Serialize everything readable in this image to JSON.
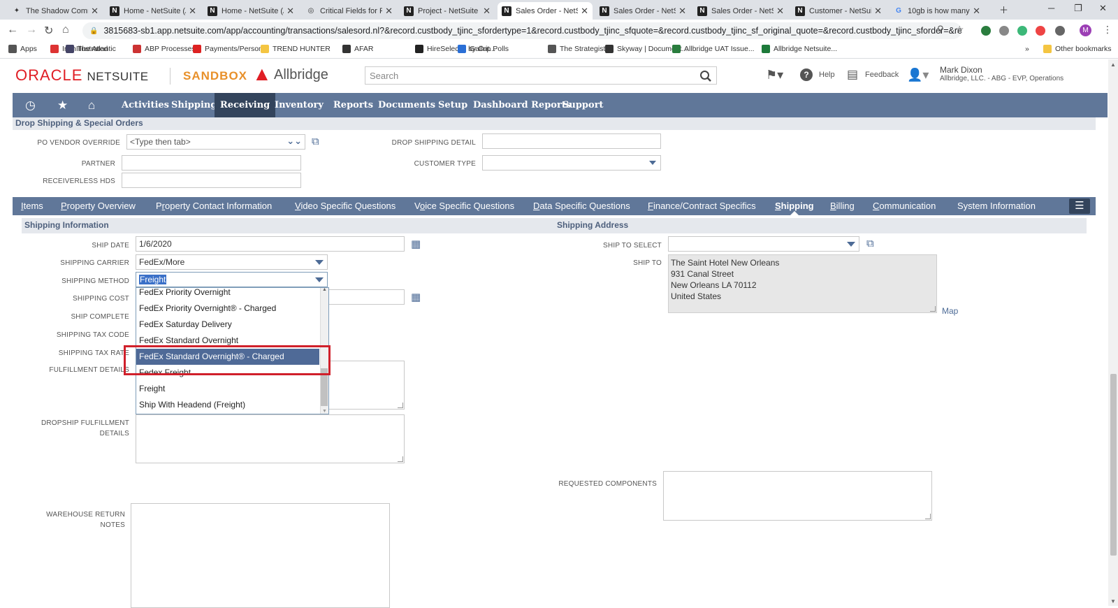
{
  "browser": {
    "tabs": [
      {
        "title": "The Shadow Comm",
        "icon": "pin-icon"
      },
      {
        "title": "Home - NetSuite (A",
        "icon": "netsuite-icon"
      },
      {
        "title": "Home - NetSuite (A",
        "icon": "netsuite-icon"
      },
      {
        "title": "Critical Fields for Fi",
        "icon": "globe-icon"
      },
      {
        "title": "Project - NetSuite (A",
        "icon": "netsuite-icon"
      },
      {
        "title": "Sales Order - NetSu",
        "icon": "netsuite-icon",
        "active": true
      },
      {
        "title": "Sales Order - NetSu",
        "icon": "netsuite-icon"
      },
      {
        "title": "Sales Order - NetSu",
        "icon": "netsuite-icon"
      },
      {
        "title": "Customer - NetSuit",
        "icon": "netsuite-icon"
      },
      {
        "title": "10gb is how many",
        "icon": "google-icon"
      }
    ],
    "url": "3815683-sb1.app.netsuite.com/app/accounting/transactions/salesord.nl?&record.custbody_tjinc_sfordertype=1&record.custbody_tjinc_sfquote=&record.custbody_tjinc_sf_original_quote=&record.custbody_tjinc_sforder=&record.c...",
    "bookmarks": [
      "Apps",
      "IrishIllustrated",
      "The Atlantic",
      "ABP Processes",
      "Payments/Personal",
      "TREND HUNTER",
      "AFAR",
      "HireSelect® by Crit...",
      "Gallup Polls",
      "The Strategist",
      "Skyway | Document...",
      "Allbridge UAT Issue...",
      "Allbridge Netsuite..."
    ],
    "other_bookmarks": "Other bookmarks",
    "profile_initial": "M"
  },
  "header": {
    "oracle": "ORACLE",
    "netsuite": "NETSUITE",
    "sandbox": "SANDBOX",
    "brand": "Allbridge",
    "search_placeholder": "Search",
    "help": "Help",
    "feedback": "Feedback",
    "user_name": "Mark Dixon",
    "user_role": "Allbridge, LLC. - ABG - EVP, Operations"
  },
  "nav": {
    "items": [
      "Activities",
      "Shipping",
      "Receiving",
      "Inventory",
      "Reports",
      "Documents",
      "Setup",
      "Dashboard Reports",
      "Support"
    ],
    "active": "Receiving"
  },
  "drop_shipping": {
    "title": "Drop Shipping & Special Orders",
    "po_vendor_override_label": "PO VENDOR OVERRIDE",
    "po_vendor_override_value": "<Type then tab>",
    "partner_label": "PARTNER",
    "receiverless_label": "RECEIVERLESS HDS",
    "drop_shipping_detail_label": "DROP SHIPPING DETAIL",
    "customer_type_label": "CUSTOMER TYPE"
  },
  "subtabs": [
    {
      "label": "Items",
      "u": "I",
      "rest": "tems"
    },
    {
      "label": "Property Overview",
      "u": "P",
      "rest": "roperty Overview"
    },
    {
      "pre": "P",
      "u": "r",
      "rest": "operty Contact Information"
    },
    {
      "u": "V",
      "rest": "ideo Specific Questions"
    },
    {
      "pre": "V",
      "u": "o",
      "rest": "ice Specific Questions"
    },
    {
      "u": "D",
      "rest": "ata Specific Questions"
    },
    {
      "u": "F",
      "rest": "inance/Contract Specifics"
    },
    {
      "u": "S",
      "rest": "hipping",
      "active": true
    },
    {
      "u": "B",
      "rest": "illing"
    },
    {
      "u": "C",
      "rest": "ommunication"
    },
    {
      "pre": "",
      "u": "",
      "rest": "System Information"
    }
  ],
  "shipping_info": {
    "title": "Shipping Information",
    "ship_date_label": "SHIP DATE",
    "ship_date_value": "1/6/2020",
    "carrier_label": "SHIPPING CARRIER",
    "carrier_value": "FedEx/More",
    "method_label": "SHIPPING METHOD",
    "method_value": "Freight",
    "cost_label": "SHIPPING COST",
    "complete_label": "SHIP COMPLETE",
    "tax_code_label": "SHIPPING TAX CODE",
    "tax_rate_label": "SHIPPING TAX RATE",
    "fulfillment_label": "FULFILLMENT DETAILS",
    "dropship_label_1": "DROPSHIP FULFILLMENT",
    "dropship_label_2": "DETAILS",
    "warehouse_label_1": "WAREHOUSE RETURN",
    "warehouse_label_2": "NOTES"
  },
  "method_options": [
    "FedEx Priority Overnight",
    "FedEx Priority Overnight® - Charged",
    "FedEx Saturday Delivery",
    "FedEx Standard Overnight",
    "FedEx Standard Overnight® - Charged",
    "Fedex Freight",
    "Freight",
    "Ship With Headend (Freight)"
  ],
  "highlighted_option_index": 4,
  "shipping_address": {
    "title": "Shipping Address",
    "ship_to_select_label": "SHIP TO SELECT",
    "ship_to_label": "SHIP TO",
    "address_line_1": "The Saint Hotel New Orleans",
    "address_line_2": "931 Canal Street",
    "address_line_3": "New Orleans LA 70112",
    "address_line_4": "United States",
    "map_link": "Map",
    "requested_components_label": "REQUESTED COMPONENTS"
  },
  "colors": {
    "nav_bg": "#607799",
    "nav_active": "#33445c",
    "highlight": "#4f6a97",
    "callout": "#d0202b",
    "sandbox": "#e8902a",
    "oracle_red": "#e01e25"
  }
}
